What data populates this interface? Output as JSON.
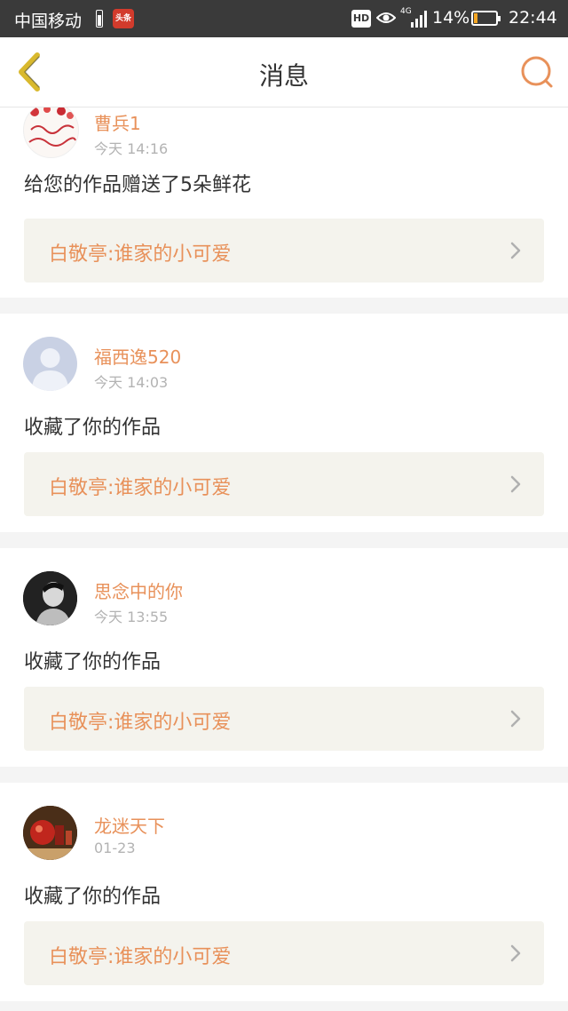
{
  "status_bar": {
    "carrier": "中国移动",
    "news_badge": "头条",
    "hd": "HD",
    "network": "4G",
    "battery": "14%",
    "battery_level": 0.14,
    "time": "22:44"
  },
  "nav": {
    "title": "消息",
    "back_icon": "chevron-left-icon",
    "search_icon": "search-icon",
    "accent_color": "#e8915a"
  },
  "messages": [
    {
      "user": "曹兵1",
      "time": "今天 14:16",
      "action": "给您的作品赠送了5朵鲜花",
      "work": "白敬亭:谁家的小可爱",
      "avatar": "birthday-cake-avatar"
    },
    {
      "user": "福西逸520",
      "time": "今天 14:03",
      "action": "收藏了你的作品",
      "work": "白敬亭:谁家的小可爱",
      "avatar": "default-person-avatar"
    },
    {
      "user": "思念中的你",
      "time": "今天 13:55",
      "action": "收藏了你的作品",
      "work": "白敬亭:谁家的小可爱",
      "avatar": "portrait-avatar"
    },
    {
      "user": "龙迷天下",
      "time": "01-23",
      "action": "收藏了你的作品",
      "work": "白敬亭:谁家的小可爱",
      "avatar": "red-ornament-avatar"
    }
  ]
}
